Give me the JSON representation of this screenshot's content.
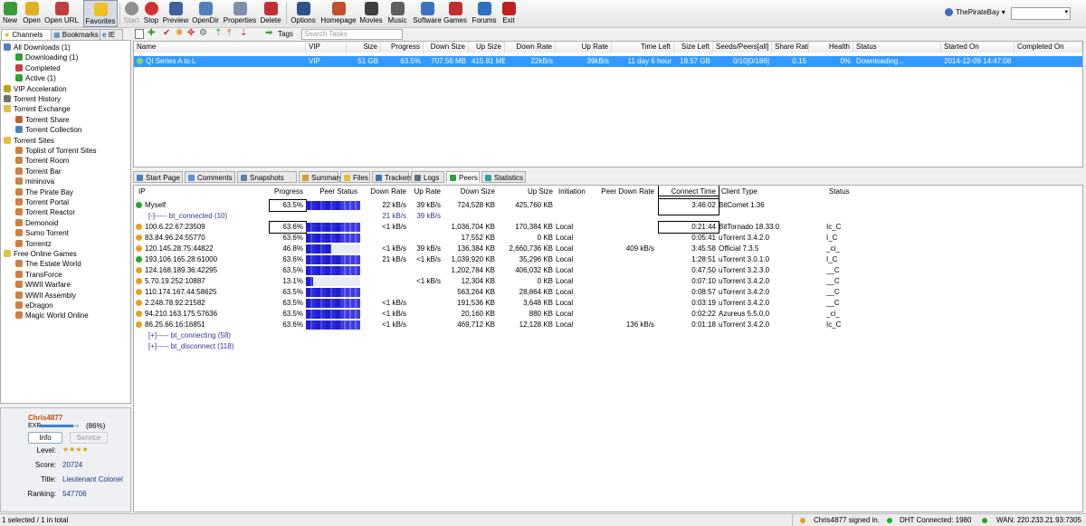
{
  "toolbar": {
    "buttons": [
      {
        "label": "New",
        "icon": "new-icon",
        "color": "#3a9a3a"
      },
      {
        "label": "Open",
        "icon": "open-folder-icon",
        "color": "#e0b020"
      },
      {
        "label": "Open URL",
        "icon": "open-url-icon",
        "color": "#c04040"
      },
      {
        "label": "Favorites",
        "icon": "star-icon",
        "color": "#f0c020"
      },
      {
        "label": "Start",
        "icon": "start-icon",
        "color": "#909090"
      },
      {
        "label": "Stop",
        "icon": "stop-icon",
        "color": "#d03030"
      },
      {
        "label": "Preview",
        "icon": "preview-icon",
        "color": "#4060a0"
      },
      {
        "label": "OpenDir",
        "icon": "open-dir-icon",
        "color": "#5080c0"
      },
      {
        "label": "Properties",
        "icon": "properties-icon",
        "color": "#8090b0"
      },
      {
        "label": "Delete",
        "icon": "delete-icon",
        "color": "#c03030"
      },
      {
        "label": "Options",
        "icon": "options-icon",
        "color": "#305090"
      },
      {
        "label": "Homepage",
        "icon": "home-icon",
        "color": "#c05030"
      },
      {
        "label": "Movies",
        "icon": "movies-icon",
        "color": "#404040"
      },
      {
        "label": "Music",
        "icon": "music-icon",
        "color": "#606060"
      },
      {
        "label": "Software",
        "icon": "software-icon",
        "color": "#4070c0"
      },
      {
        "label": "Games",
        "icon": "games-icon",
        "color": "#c03030"
      },
      {
        "label": "Forums",
        "icon": "forums-icon",
        "color": "#3070c0"
      },
      {
        "label": "Exit",
        "icon": "exit-icon",
        "color": "#c02020"
      }
    ],
    "site": "ThePirateBay"
  },
  "left_tabs": [
    "Channels",
    "Bookmarks",
    "IE"
  ],
  "tree": [
    {
      "label": "All Downloads (1)",
      "level": 0,
      "color": "#5080c0"
    },
    {
      "label": "Downloading (1)",
      "level": 1,
      "color": "#30a030"
    },
    {
      "label": "Completed",
      "level": 1,
      "color": "#d04040"
    },
    {
      "label": "Active (1)",
      "level": 1,
      "color": "#30a030"
    },
    {
      "label": "VIP Acceleration",
      "level": 0,
      "color": "#c0a020"
    },
    {
      "label": "Torrent History",
      "level": 0,
      "color": "#707070"
    },
    {
      "label": "Torrent Exchange",
      "level": 0,
      "color": "#e0c040"
    },
    {
      "label": "Torrent Share",
      "level": 1,
      "color": "#c06030"
    },
    {
      "label": "Torrent Collection",
      "level": 1,
      "color": "#5080c0"
    },
    {
      "label": "Torrent Sites",
      "level": 0,
      "color": "#e0c040"
    },
    {
      "label": "Toplist of Torrent Sites",
      "level": 1,
      "color": "#d08040"
    },
    {
      "label": "Torrent Room",
      "level": 1,
      "color": "#d08040"
    },
    {
      "label": "Torrent Bar",
      "level": 1,
      "color": "#d08040"
    },
    {
      "label": "mininova",
      "level": 1,
      "color": "#d08040"
    },
    {
      "label": "The Pirate Bay",
      "level": 1,
      "color": "#d08040"
    },
    {
      "label": "Torrent Portal",
      "level": 1,
      "color": "#d08040"
    },
    {
      "label": "Torrent Reactor",
      "level": 1,
      "color": "#d08040"
    },
    {
      "label": "Demonoid",
      "level": 1,
      "color": "#d08040"
    },
    {
      "label": "Sumo Torrent",
      "level": 1,
      "color": "#d08040"
    },
    {
      "label": "Torrentz",
      "level": 1,
      "color": "#d08040"
    },
    {
      "label": "Free Online Games",
      "level": 0,
      "color": "#e0c040"
    },
    {
      "label": "The Estate World",
      "level": 1,
      "color": "#d08040"
    },
    {
      "label": "TransForce",
      "level": 1,
      "color": "#d08040"
    },
    {
      "label": "WWII Warfare",
      "level": 1,
      "color": "#d08040"
    },
    {
      "label": "WWII Assembly",
      "level": 1,
      "color": "#d08040"
    },
    {
      "label": "eDragon",
      "level": 1,
      "color": "#d08040"
    },
    {
      "label": "Magic World Online",
      "level": 1,
      "color": "#d08040"
    }
  ],
  "profile": {
    "username": "Chris4877",
    "exp_label": "EXP",
    "exp_percent": 86,
    "exp_text": "(86%)",
    "tab_info": "Info",
    "tab_service": "Service",
    "level_label": "Level:",
    "level_stars": 4,
    "score_label": "Score:",
    "score": "20724",
    "title_label": "Title:",
    "title": "Lieutenant Colonel",
    "ranking_label": "Ranking:",
    "ranking": "547706"
  },
  "task_toolbar": {
    "tags_label": "Tags",
    "search_placeholder": "Search Tasks"
  },
  "task_columns": [
    "Name",
    "VIP",
    "Size",
    "Progress",
    "Down Size",
    "Up Size",
    "Down Rate",
    "Up Rate",
    "Time Left",
    "Size Left",
    "Seeds/Peers[all]",
    "Share Ratio",
    "Health",
    "Status",
    "Started On",
    "Completed On"
  ],
  "task": {
    "name": "QI Series A to L",
    "vip": "VIP",
    "size": "51 GB",
    "progress": "63.5%",
    "down_size": "707.56 MB",
    "up_size": "415.81 MB",
    "down_rate": "22kB/s",
    "up_rate": "39kB/s",
    "time_left": "11 day 6 hour",
    "size_left": "18.57 GB",
    "seeds_peers": "0/10[0/186]",
    "share_ratio": "0.15",
    "health": "0%",
    "status": "Downloading...",
    "started_on": "2014-12-09 14:47:08",
    "completed_on": ""
  },
  "detail_tabs": [
    {
      "label": "Start Page",
      "icon": "start-page-icon",
      "color": "#5080c0"
    },
    {
      "label": "Comments",
      "icon": "comments-icon",
      "color": "#6090d0"
    },
    {
      "label": "Snapshots",
      "icon": "snapshots-icon",
      "color": "#6080a0"
    },
    {
      "label": "Summary",
      "icon": "summary-icon",
      "color": "#d0a030"
    },
    {
      "label": "Files",
      "icon": "files-icon",
      "color": "#e0c040"
    },
    {
      "label": "Trackers",
      "icon": "trackers-icon",
      "color": "#4070b0"
    },
    {
      "label": "Logs",
      "icon": "logs-icon",
      "color": "#607080"
    },
    {
      "label": "Peers",
      "icon": "peers-icon",
      "color": "#30a040"
    },
    {
      "label": "Statistics",
      "icon": "statistics-icon",
      "color": "#30a0a0"
    }
  ],
  "peer_columns": [
    "IP",
    "Progress",
    "Peer Status",
    "Down Rate",
    "Up Rate",
    "Down Size",
    "Up Size",
    "Initiation",
    "Peer Down Rate",
    "Connect Time",
    "Client Type",
    "Status"
  ],
  "peers_myself": {
    "ip": "Myself",
    "progress": "63.5%",
    "progress_value": 63.5,
    "down_rate": "22 kB/s",
    "up_rate": "39 kB/s",
    "down_size": "724,528 KB",
    "up_size": "425,760 KB",
    "connect_time": "3:46:02",
    "client": "BitComet 1.36"
  },
  "group_connected": {
    "label": "[-]----- bt_connected (10)",
    "down_rate": "21 kB/s",
    "up_rate": "39 kB/s"
  },
  "peers": [
    {
      "ip": "100.6.22.67:23509",
      "progress": "63.6%",
      "progress_value": 63.6,
      "down_rate": "<1 kB/s",
      "up_rate": "",
      "down_size": "1,036,704 KB",
      "up_size": "170,384 KB",
      "initiation": "Local",
      "peer_down_rate": "",
      "connect_time": "0:21:44",
      "client": "BitTornado 18.33.0",
      "status": "Ic_C",
      "icon": "orange"
    },
    {
      "ip": "83.84.96.24:55770",
      "progress": "63.6%",
      "progress_value": 63.6,
      "down_rate": "",
      "up_rate": "",
      "down_size": "17,552 KB",
      "up_size": "0 KB",
      "initiation": "Local",
      "peer_down_rate": "",
      "connect_time": "0:05:41",
      "client": "uTorrent 3.4.2.0",
      "status": "I_C",
      "icon": "orange"
    },
    {
      "ip": "120.145.28.75:44822",
      "progress": "46.8%",
      "progress_value": 46.8,
      "down_rate": "<1 kB/s",
      "up_rate": "39 kB/s",
      "down_size": "136,384 KB",
      "up_size": "2,660,736 KB",
      "initiation": "Local",
      "peer_down_rate": "409 kB/s",
      "connect_time": "3:45:58",
      "client": "Official 7.3.5",
      "status": "_ci_",
      "icon": "orange"
    },
    {
      "ip": "193.106.165.28:61000",
      "progress": "63.6%",
      "progress_value": 63.6,
      "down_rate": "21 kB/s",
      "up_rate": "<1 kB/s",
      "down_size": "1,039,920 KB",
      "up_size": "35,296 KB",
      "initiation": "Local",
      "peer_down_rate": "",
      "connect_time": "1:28:51",
      "client": "uTorrent 3.0.1.0",
      "status": "I_C",
      "icon": "green"
    },
    {
      "ip": "124.168.189.36:42295",
      "progress": "63.5%",
      "progress_value": 63.5,
      "down_rate": "",
      "up_rate": "",
      "down_size": "1,202,784 KB",
      "up_size": "406,032 KB",
      "initiation": "Local",
      "peer_down_rate": "",
      "connect_time": "0:47:50",
      "client": "uTorrent 3.2.3.0",
      "status": "__C",
      "icon": "orange"
    },
    {
      "ip": "5.70.19.252:10887",
      "progress": "13.1%",
      "progress_value": 13.1,
      "down_rate": "",
      "up_rate": "<1 kB/s",
      "down_size": "12,304 KB",
      "up_size": "0 KB",
      "initiation": "Local",
      "peer_down_rate": "",
      "connect_time": "0:07:10",
      "client": "uTorrent 3.4.2.0",
      "status": "__C",
      "icon": "orange"
    },
    {
      "ip": "110.174.167.44:58625",
      "progress": "63.5%",
      "progress_value": 63.5,
      "down_rate": "",
      "up_rate": "",
      "down_size": "563,264 KB",
      "up_size": "28,864 KB",
      "initiation": "Local",
      "peer_down_rate": "",
      "connect_time": "0:08:57",
      "client": "uTorrent 3.4.2.0",
      "status": "__C",
      "icon": "orange"
    },
    {
      "ip": "2.248.78.92:21582",
      "progress": "63.5%",
      "progress_value": 63.5,
      "down_rate": "<1 kB/s",
      "up_rate": "",
      "down_size": "191,536 KB",
      "up_size": "3,648 KB",
      "initiation": "Local",
      "peer_down_rate": "",
      "connect_time": "0:03:19",
      "client": "uTorrent 3.4.2.0",
      "status": "__C",
      "icon": "orange"
    },
    {
      "ip": "94.210.163.175:57636",
      "progress": "63.5%",
      "progress_value": 63.5,
      "down_rate": "<1 kB/s",
      "up_rate": "",
      "down_size": "20,160 KB",
      "up_size": "880 KB",
      "initiation": "Local",
      "peer_down_rate": "",
      "connect_time": "0:02:22",
      "client": "Azureus 5.5.0.0",
      "status": "_ci_",
      "icon": "orange"
    },
    {
      "ip": "86.25.66.16:16851",
      "progress": "63.6%",
      "progress_value": 63.6,
      "down_rate": "<1 kB/s",
      "up_rate": "",
      "down_size": "469,712 KB",
      "up_size": "12,128 KB",
      "initiation": "Local",
      "peer_down_rate": "136 kB/s",
      "connect_time": "0:01:18",
      "client": "uTorrent 3.4.2.0",
      "status": "Ic_C",
      "icon": "orange"
    }
  ],
  "group_connecting": "[+]----- bt_connecting (58)",
  "group_disconnect": "[+]----- bt_disconnect (118)",
  "statusbar": {
    "selection": "1 selected / 1 in total",
    "signed_in": "Chris4877 signed in.",
    "dht": "DHT Connected: 1980",
    "wan": "WAN: 220.233.21.93:7305"
  },
  "colors": {
    "accent": "#3399ff",
    "peer_bar": "#2b2bd6",
    "status_green": "#22aa22",
    "status_orange": "#e8a020"
  }
}
